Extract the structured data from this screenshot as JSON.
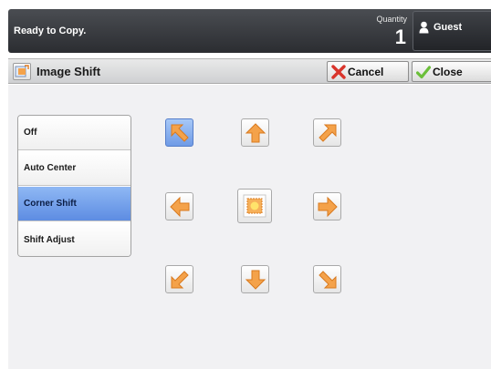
{
  "status": {
    "message": "Ready to Copy.",
    "quantity_label": "Quantity",
    "quantity_value": "1",
    "user_label": "Guest"
  },
  "titlebar": {
    "title": "Image Shift",
    "cancel_label": "Cancel",
    "close_label": "Close"
  },
  "options": [
    {
      "label": "Off",
      "selected": false
    },
    {
      "label": "Auto Center",
      "selected": false
    },
    {
      "label": "Corner Shift",
      "selected": true
    },
    {
      "label": "Shift Adjust",
      "selected": false
    }
  ],
  "shift_grid": {
    "selected": "upper-left",
    "icons": [
      "arrow-up-left-icon",
      "arrow-up-icon",
      "arrow-up-right-icon",
      "arrow-left-icon",
      "center-icon",
      "arrow-right-icon",
      "arrow-down-left-icon",
      "arrow-down-icon",
      "arrow-down-right-icon"
    ]
  },
  "colors": {
    "accent_selected": "#6f9be6",
    "arrow_orange": "#f4a24a",
    "top_bar": "#2b2d31",
    "cancel_red": "#d9342b",
    "close_green": "#6bbf3a"
  }
}
